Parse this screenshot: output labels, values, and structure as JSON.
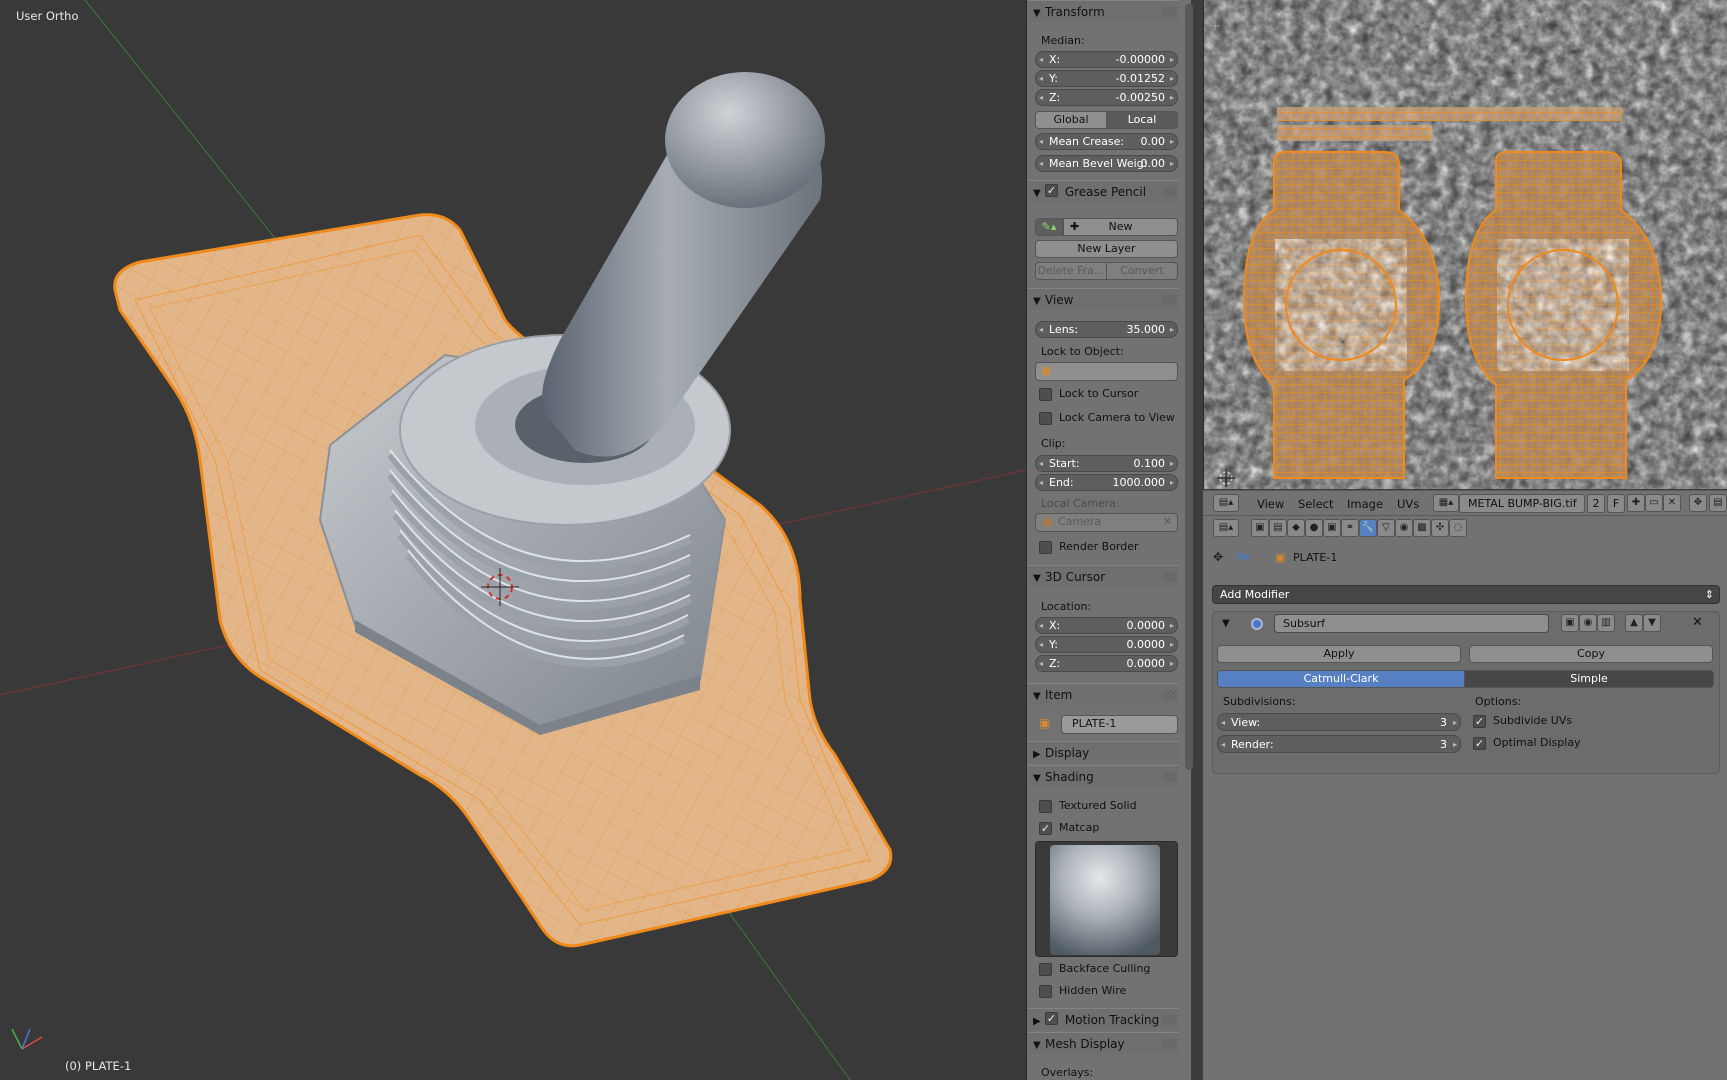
{
  "viewport": {
    "view_name": "User Ortho",
    "status": "(0) PLATE-1"
  },
  "npanel": {
    "transform": {
      "title": "Transform",
      "median_label": "Median:",
      "x_key": "X:",
      "x_val": "-0.00000",
      "y_key": "Y:",
      "y_val": "-0.01252",
      "z_key": "Z:",
      "z_val": "-0.00250",
      "global": "Global",
      "local": "Local",
      "crease_key": "Mean Crease:",
      "crease_val": "0.00",
      "bevel_key": "Mean Bevel Weig:",
      "bevel_val": "0.00"
    },
    "grease": {
      "title": "Grease Pencil",
      "new": "New",
      "new_layer": "New Layer",
      "delete_frame": "Delete Fra...",
      "convert": "Convert"
    },
    "view": {
      "title": "View",
      "lens_key": "Lens:",
      "lens_val": "35.000",
      "lock_obj": "Lock to Object:",
      "lock_cursor": "Lock to Cursor",
      "lock_camera": "Lock Camera to View",
      "clip": "Clip:",
      "start_key": "Start:",
      "start_val": "0.100",
      "end_key": "End:",
      "end_val": "1000.000",
      "local_camera": "Local Camera:",
      "camera": "Camera",
      "render_border": "Render Border"
    },
    "cursor": {
      "title": "3D Cursor",
      "location": "Location:",
      "x_key": "X:",
      "x_val": "0.0000",
      "y_key": "Y:",
      "y_val": "0.0000",
      "z_key": "Z:",
      "z_val": "0.0000"
    },
    "item": {
      "title": "Item",
      "name": "PLATE-1"
    },
    "display": {
      "title": "Display"
    },
    "shading": {
      "title": "Shading",
      "textured_solid": "Textured Solid",
      "matcap": "Matcap",
      "backface": "Backface Culling",
      "hidden_wire": "Hidden Wire"
    },
    "motion": {
      "title": "Motion Tracking"
    },
    "mesh_display": {
      "title": "Mesh Display",
      "overlays": "Overlays:"
    }
  },
  "uv_header": {
    "view": "View",
    "select": "Select",
    "image": "Image",
    "uvs": "UVs",
    "image_name": "METAL BUMP-BIG.tif",
    "users": "2",
    "fake": "F"
  },
  "props": {
    "breadcrumb": "PLATE-1",
    "add_modifier": "Add Modifier",
    "mod_name": "Subsurf",
    "apply": "Apply",
    "copy": "Copy",
    "catmull": "Catmull-Clark",
    "simple": "Simple",
    "subdivisions": "Subdivisions:",
    "view_key": "View:",
    "view_val": "3",
    "render_key": "Render:",
    "render_val": "3",
    "options": "Options:",
    "subdivide_uvs": "Subdivide UVs",
    "optimal_display": "Optimal Display"
  },
  "colors": {
    "mesh_orange": "#f39a2a",
    "plate_fill": "#e7b98b",
    "active_blue": "#5680c2",
    "panel_bg": "#727272"
  }
}
